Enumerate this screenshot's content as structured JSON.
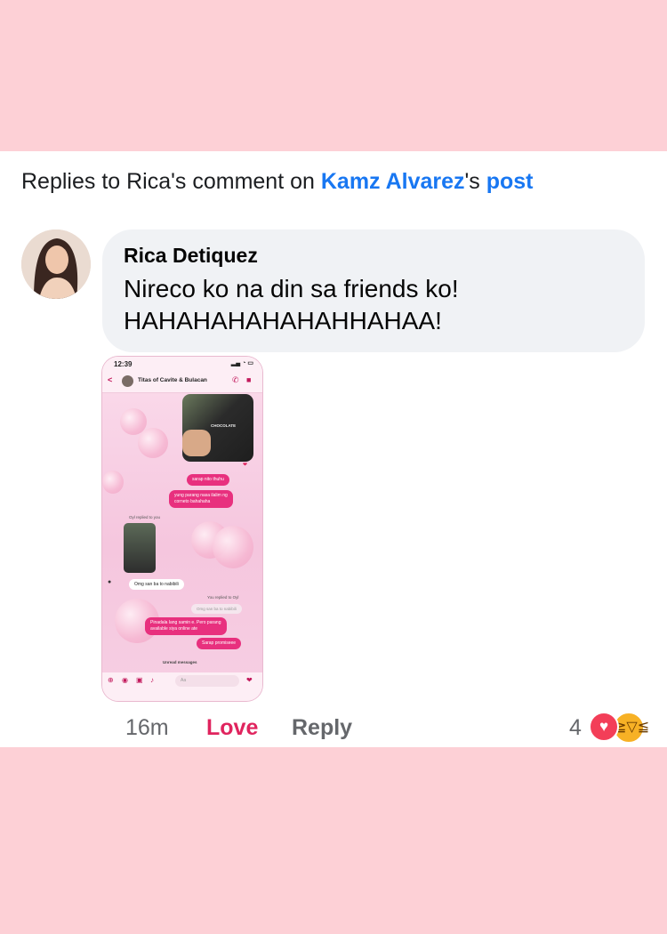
{
  "header": {
    "prefix": "Replies to Rica's comment on ",
    "author": "Kamz Alvarez",
    "possessive": "'s ",
    "post": "post"
  },
  "comment": {
    "name": "Rica Detiquez",
    "line1": "Nireco ko na din sa friends ko!",
    "line2": "HAHAHAHAHAHAHHAHAA!"
  },
  "screenshot": {
    "time": "12:39",
    "chat_title": "Titas of Cavite & Bulacan",
    "product_label": "CHOCOLATE",
    "bubbles": {
      "sarap": "sarap nito thuhu",
      "yung1": "yung parang nasa ilalim ng",
      "yung2": "corneto bahahaha",
      "replied": "Oyl replied to you",
      "omg": "Omg san ba to nabibili",
      "you_replied": "You replied to Oyl",
      "omg_faded": "Omg san ba to nabibili",
      "pinadala1": "Pinadala lang samin e. Pero parang",
      "pinadala2": "available siya online ate",
      "promise": "Sarap promiseee",
      "unread": "Unread messages",
      "input": "Aa"
    }
  },
  "actions": {
    "time": "16m",
    "love": "Love",
    "reply": "Reply",
    "reaction_count": "4"
  },
  "colors": {
    "background": "#fdd0d6",
    "link": "#1877f2",
    "love": "#e0245e"
  }
}
